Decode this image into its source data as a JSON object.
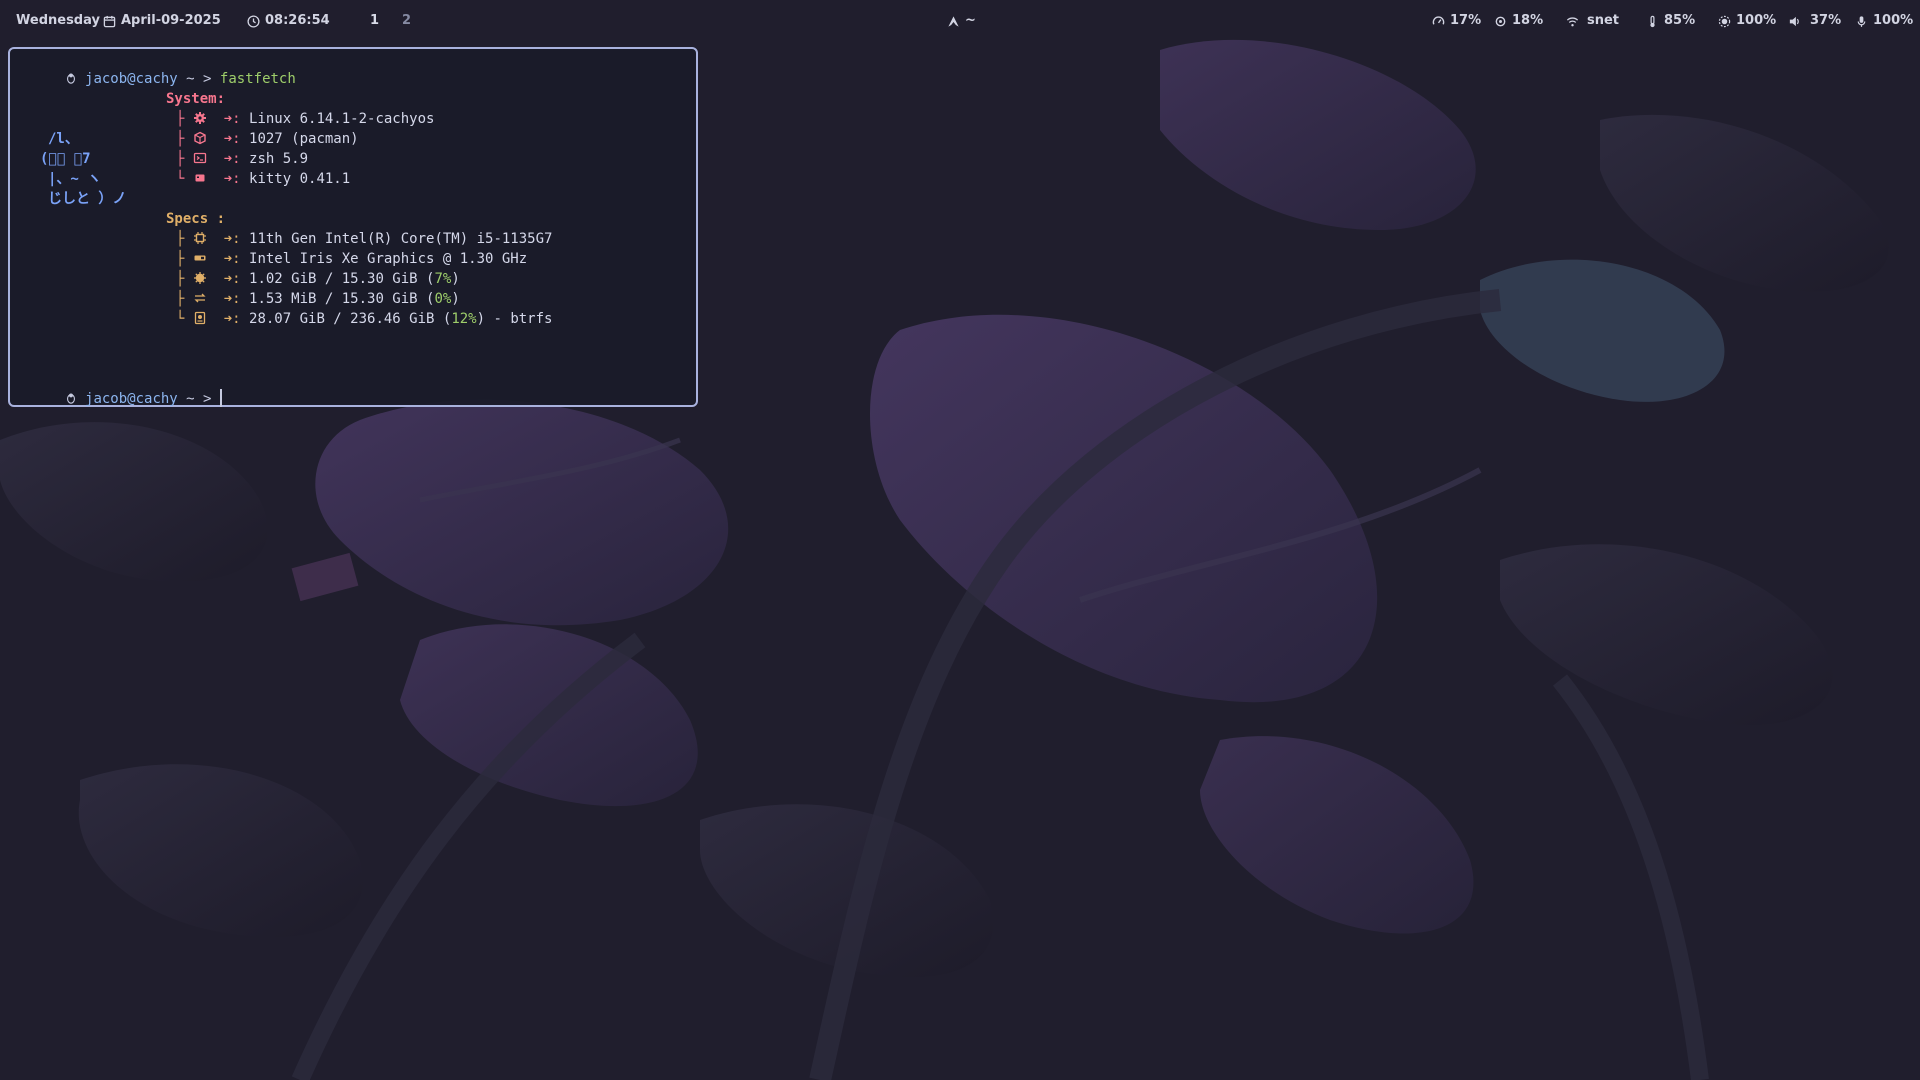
{
  "topbar": {
    "day": "Wednesday",
    "date": "April-09-2025",
    "time": "08:26:54",
    "workspaces": [
      "1",
      "2"
    ],
    "active_workspace": "1",
    "window_title": "~",
    "cpu": "17%",
    "memory": "18%",
    "network": "snet",
    "temperature": "85%",
    "brightness": "100%",
    "volume": "37%",
    "microphone": "100%"
  },
  "terminal": {
    "prompt_user": "jacob@cachy",
    "prompt_dir": "~",
    "prompt_arrow": ">",
    "command": "fastfetch",
    "ascii_art": [
      "/l、",
      "(ﾟ､ ｡7",
      "|、~ ヽ",
      "じしと ）ノ"
    ],
    "system": {
      "header": "System:",
      "rows": [
        {
          "icon": "gear-icon",
          "value": "Linux 6.14.1-2-cachyos"
        },
        {
          "icon": "package-icon",
          "value": "1027 (pacman)"
        },
        {
          "icon": "terminal-prompt-icon",
          "value": "zsh 5.9"
        },
        {
          "icon": "kitty-icon",
          "value": "kitty 0.41.1"
        }
      ]
    },
    "specs": {
      "header": "Specs :",
      "rows": [
        {
          "icon": "cpu-icon",
          "value": "11th Gen Intel(R) Core(TM) i5-1135G7"
        },
        {
          "icon": "gpu-icon",
          "value": "Intel Iris Xe Graphics @ 1.30 GHz"
        },
        {
          "icon": "memory-icon",
          "pre": "1.02 GiB / 15.30 GiB (",
          "pct": "7%",
          "post": ")"
        },
        {
          "icon": "swap-icon",
          "pre": "1.53 MiB / 15.30 GiB (",
          "pct": "0%",
          "post": ")"
        },
        {
          "icon": "disk-icon",
          "pre": "28.07 GiB / 236.46 GiB (",
          "pct": "12%",
          "post": ") - btrfs"
        }
      ]
    },
    "row_sep": "➜:",
    "colors": {
      "accent_blue": "#8cb5ef",
      "command_green": "#9ece6a",
      "system_red": "#f7768e",
      "specs_yellow": "#e0af68",
      "border": "#a9b2de"
    }
  }
}
